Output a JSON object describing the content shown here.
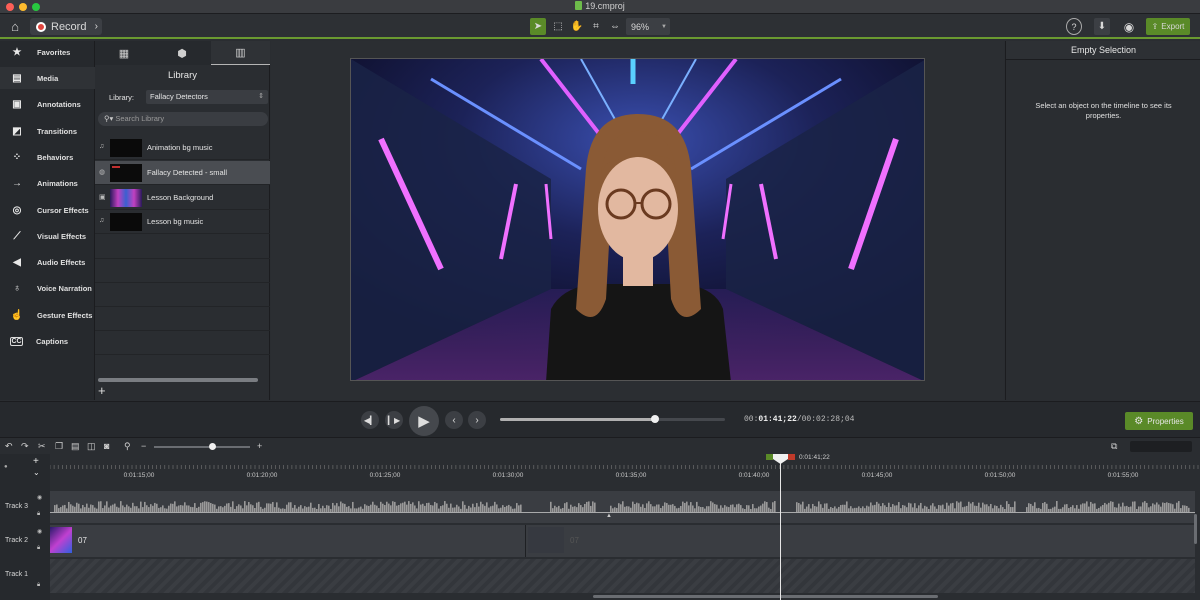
{
  "window": {
    "title": "19.cmproj"
  },
  "toolbar": {
    "record_label": "Record",
    "zoom_value": "96%",
    "help_label": "?",
    "export_label": "Export"
  },
  "sidebar": {
    "items": [
      {
        "label": "Favorites",
        "icon": "star-icon"
      },
      {
        "label": "Media",
        "icon": "film-icon"
      },
      {
        "label": "Annotations",
        "icon": "annotation-icon"
      },
      {
        "label": "Transitions",
        "icon": "transition-icon"
      },
      {
        "label": "Behaviors",
        "icon": "behaviors-icon"
      },
      {
        "label": "Animations",
        "icon": "animation-icon"
      },
      {
        "label": "Cursor Effects",
        "icon": "cursor-icon"
      },
      {
        "label": "Visual Effects",
        "icon": "wand-icon"
      },
      {
        "label": "Audio Effects",
        "icon": "speaker-icon"
      },
      {
        "label": "Voice Narration",
        "icon": "microphone-icon"
      },
      {
        "label": "Gesture Effects",
        "icon": "hand-icon"
      },
      {
        "label": "Captions",
        "icon": "captions-icon"
      }
    ]
  },
  "library": {
    "title": "Library",
    "select_label": "Library:",
    "select_value": "Fallacy Detectors",
    "search_placeholder": "Search Library",
    "items": [
      {
        "name": "Animation bg music",
        "type_icon": "music-note-icon"
      },
      {
        "name": "Fallacy Detected - small",
        "type_icon": "group-icon",
        "selected": true
      },
      {
        "name": "Lesson Background",
        "type_icon": "image-icon"
      },
      {
        "name": "Lesson bg music",
        "type_icon": "music-note-icon"
      }
    ]
  },
  "properties": {
    "title": "Empty Selection",
    "message": "Select an object on the timeline to see its properties.",
    "button_label": "Properties"
  },
  "playback": {
    "current_prefix": "00:",
    "current_time": "01:41;22",
    "separator": "/",
    "total_time": "00:02:28;04",
    "progress": 0.687
  },
  "timeline": {
    "zoom_level": 0.6,
    "playhead_time": "0:01:41;22",
    "ruler_ticks": [
      "0:01:15;00",
      "0:01:20;00",
      "0:01:25;00",
      "0:01:30;00",
      "0:01:35;00",
      "0:01:40;00",
      "0:01:45;00",
      "0:01:50;00",
      "0:01:55;00"
    ],
    "tracks": [
      {
        "label": "Track 3"
      },
      {
        "label": "Track 2",
        "clip_label": "07",
        "ghost_label": "07"
      },
      {
        "label": "Track 1"
      }
    ]
  },
  "colors": {
    "accent_green": "#5a8a28",
    "record_red": "#e0453f"
  }
}
